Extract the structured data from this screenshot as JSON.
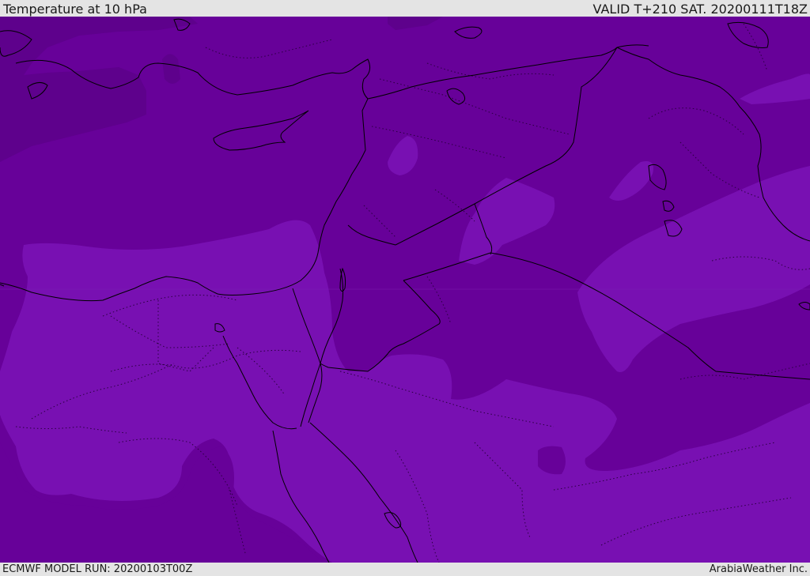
{
  "header": {
    "title": "Temperature at 10 hPa",
    "valid": "VALID T+210 SAT. 20200111T18Z"
  },
  "footer": {
    "run": "ECMWF MODEL RUN: 20200103T00Z",
    "credit": "ArabiaWeather Inc."
  },
  "colors": {
    "dark_band": "#5e018c",
    "mid_band": "#670199",
    "light_band": "#7810b2",
    "coastline": "#000000",
    "border_dotted": "#2a0040"
  }
}
